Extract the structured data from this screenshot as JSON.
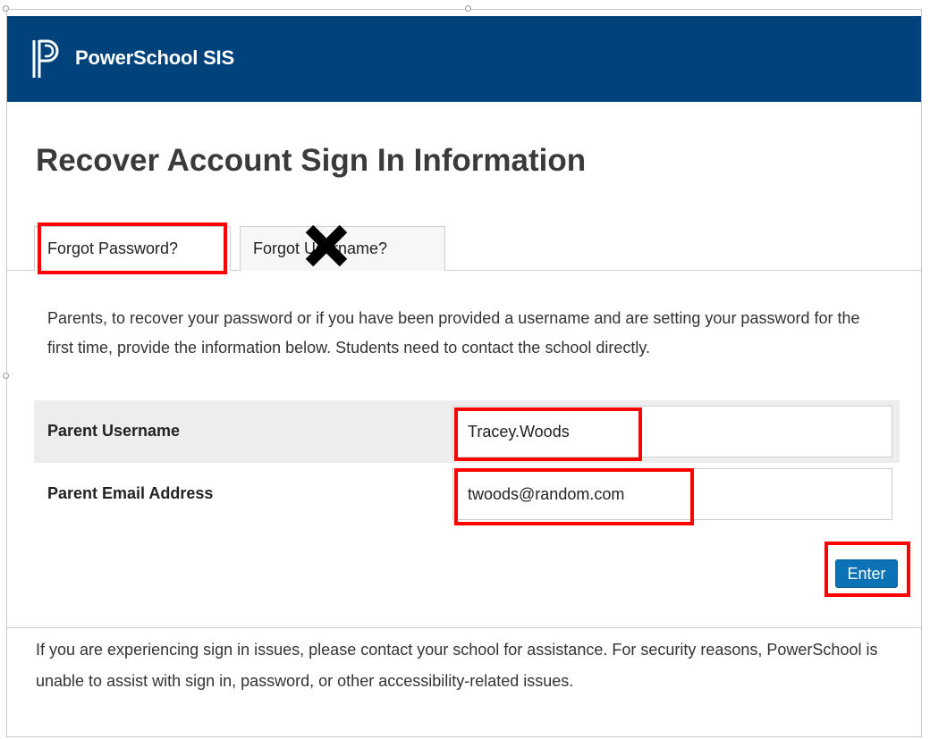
{
  "header": {
    "brand": "PowerSchool SIS",
    "logo_icon": "powerschool-logo-icon",
    "color": "#00427c"
  },
  "page": {
    "title": "Recover Account Sign In Information"
  },
  "tabs": [
    {
      "label": "Forgot Password?",
      "active": true
    },
    {
      "label": "Forgot Username?",
      "active": false
    }
  ],
  "instructions": "Parents, to recover your password or if you have been provided a username and are setting your password for the first time, provide the information below. Students need to contact the school directly.",
  "form": {
    "username_label": "Parent Username",
    "username_value": "Tracey.Woods",
    "email_label": "Parent Email Address",
    "email_value": "twoods@random.com",
    "submit_label": "Enter"
  },
  "footer": {
    "text": "If you are experiencing sign in issues, please contact your school for assistance. For security reasons, PowerSchool is unable to assist with sign in, password, or other accessibility-related issues."
  },
  "annotations": {
    "highlight_color": "#ff0000",
    "cross_icon": "x-mark-icon"
  }
}
